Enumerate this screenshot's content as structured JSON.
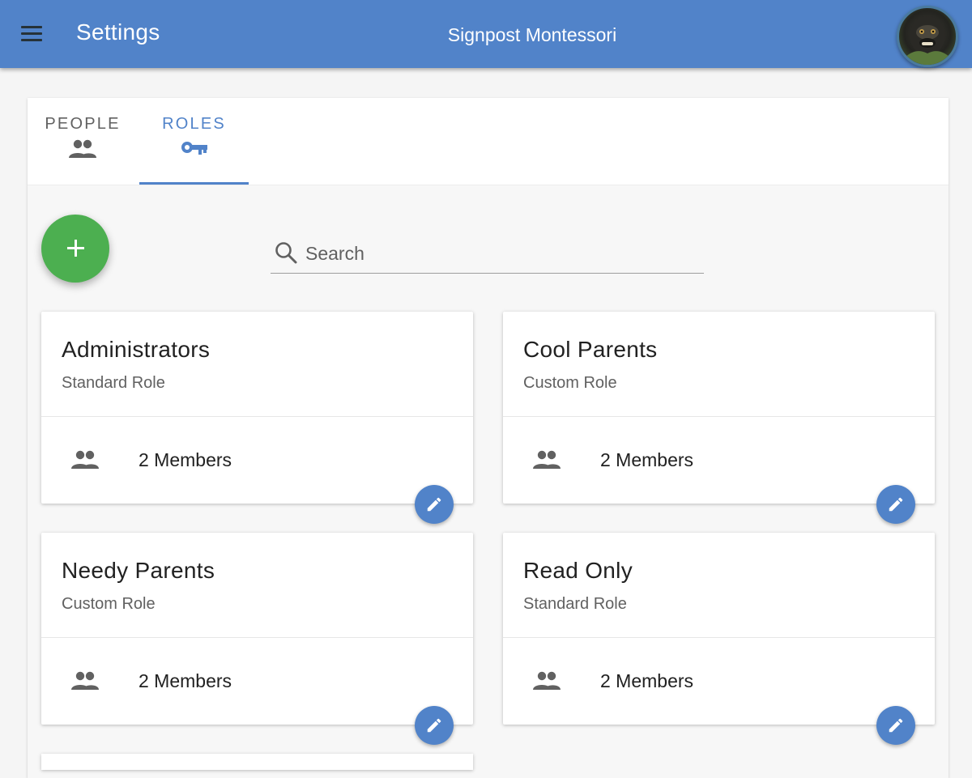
{
  "appbar": {
    "title": "Settings",
    "org_name": "Signpost Montessori",
    "menu_icon": "menu-icon",
    "avatar_icon": "user-avatar"
  },
  "tabs": [
    {
      "label": "PEOPLE",
      "icon": "people-icon",
      "active": false
    },
    {
      "label": "ROLES",
      "icon": "key-icon",
      "active": true
    }
  ],
  "search": {
    "placeholder": "Search",
    "value": ""
  },
  "fab": {
    "icon": "add-icon"
  },
  "roles": [
    {
      "name": "Administrators",
      "type": "Standard Role",
      "members": "2 Members"
    },
    {
      "name": "Cool Parents",
      "type": "Custom Role",
      "members": "2 Members"
    },
    {
      "name": "Needy Parents",
      "type": "Custom Role",
      "members": "2 Members"
    },
    {
      "name": "Read Only",
      "type": "Standard Role",
      "members": "2 Members"
    }
  ],
  "colors": {
    "primary": "#5183c9",
    "fab": "#4caf50",
    "text_primary": "#212121",
    "text_secondary": "#616161"
  }
}
